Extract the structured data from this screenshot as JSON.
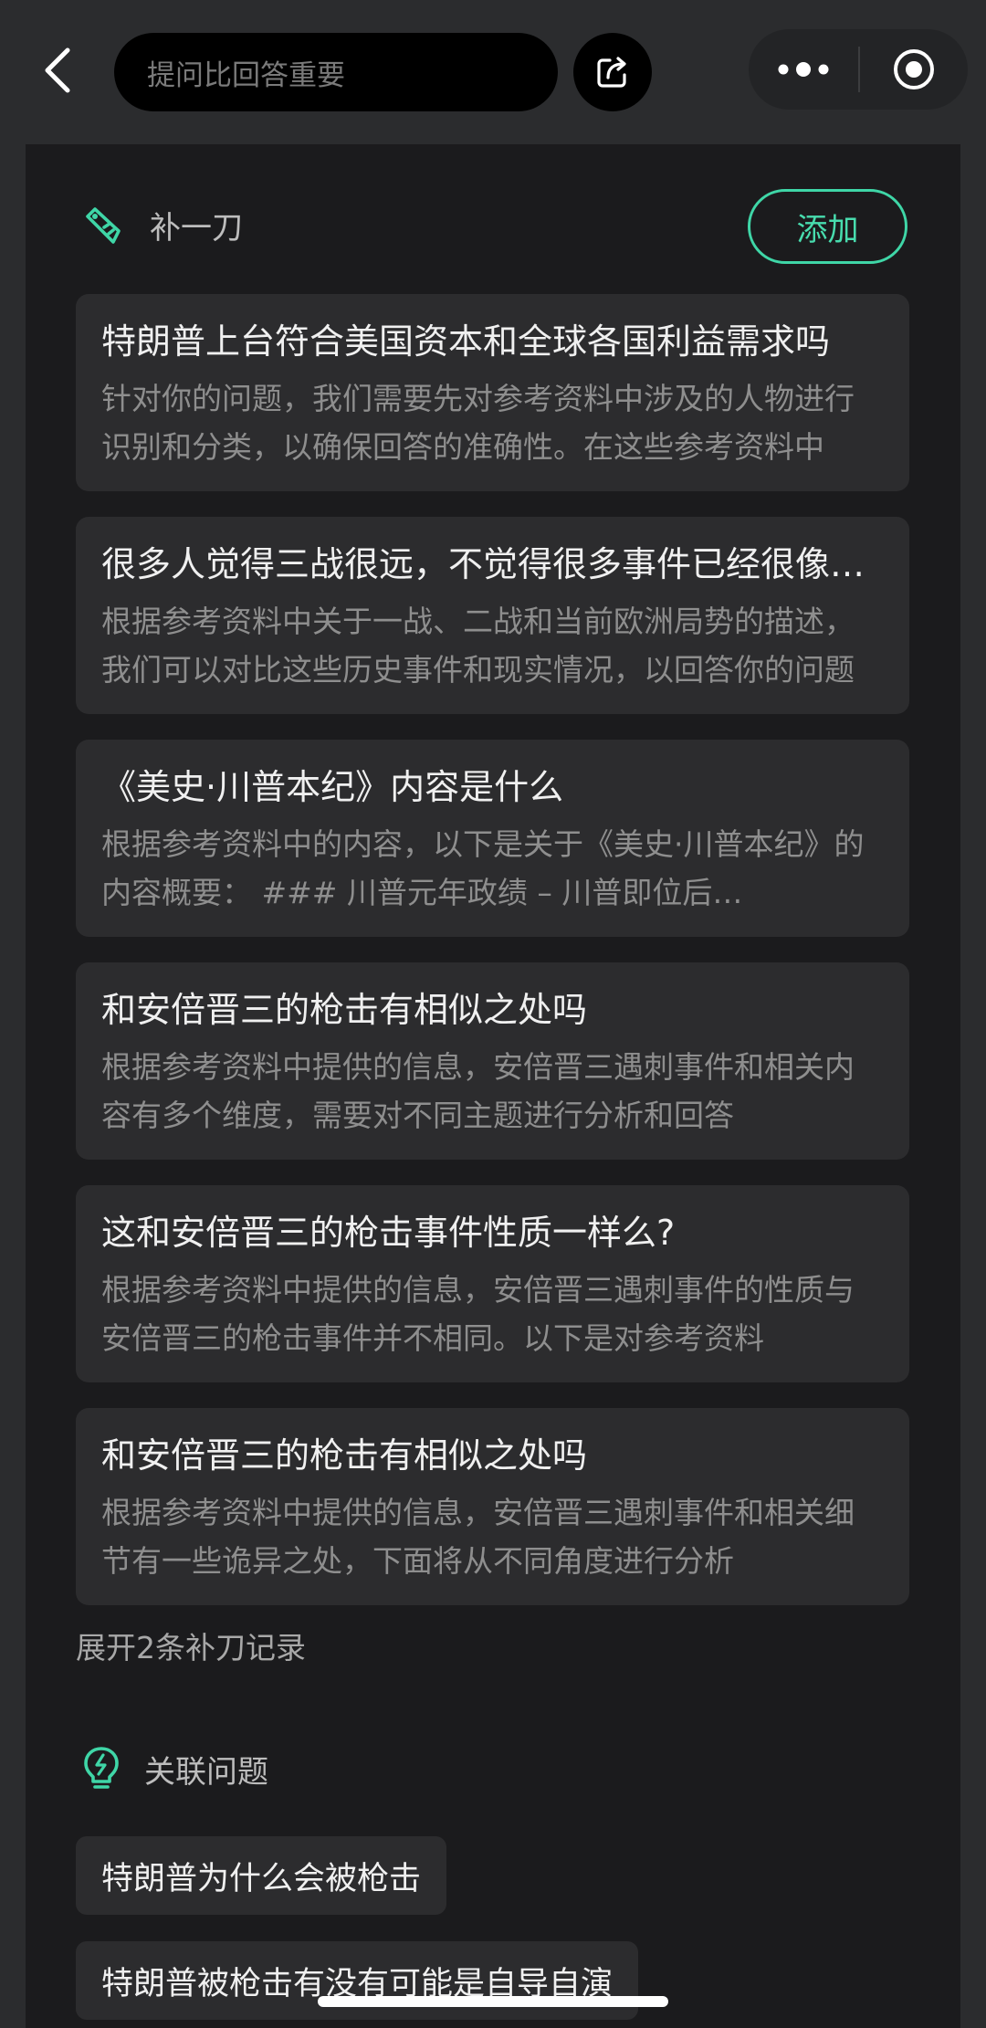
{
  "header": {
    "search_placeholder": "提问比回答重要"
  },
  "supplement": {
    "title": "补一刀",
    "add_label": "添加",
    "items": [
      {
        "question": "特朗普上台符合美国资本和全球各国利益需求吗",
        "answer": "针对你的问题，我们需要先对参考资料中涉及的人物进行识别和分类，以确保回答的准确性。在这些参考资料中"
      },
      {
        "question": "很多人觉得三战很远，不觉得很多事件已经很像了吗",
        "answer": "根据参考资料中关于一战、二战和当前欧洲局势的描述，我们可以对比这些历史事件和现实情况，以回答你的问题"
      },
      {
        "question": "《美史·川普本纪》内容是什么",
        "answer": "根据参考资料中的内容，以下是关于《美史·川普本纪》的内容概要： ### 川普元年政绩 – 川普即位后…"
      },
      {
        "question": "和安倍晋三的枪击有相似之处吗",
        "answer": "根据参考资料中提供的信息，安倍晋三遇刺事件和相关内容有多个维度，需要对不同主题进行分析和回答"
      },
      {
        "question": "这和安倍晋三的枪击事件性质一样么?",
        "answer": "根据参考资料中提供的信息，安倍晋三遇刺事件的性质与安倍晋三的枪击事件并不相同。以下是对参考资料"
      },
      {
        "question": "和安倍晋三的枪击有相似之处吗",
        "answer": "根据参考资料中提供的信息，安倍晋三遇刺事件和相关细节有一些诡异之处，下面将从不同角度进行分析"
      }
    ],
    "expand_label": "展开2条补刀记录"
  },
  "related": {
    "title": "关联问题",
    "items": [
      "特朗普为什么会被枪击",
      "特朗普被枪击有没有可能是自导自演"
    ]
  },
  "colors": {
    "accent": "#3fd6a7",
    "background": "#1b1b1d",
    "card": "#2c2c2e"
  }
}
